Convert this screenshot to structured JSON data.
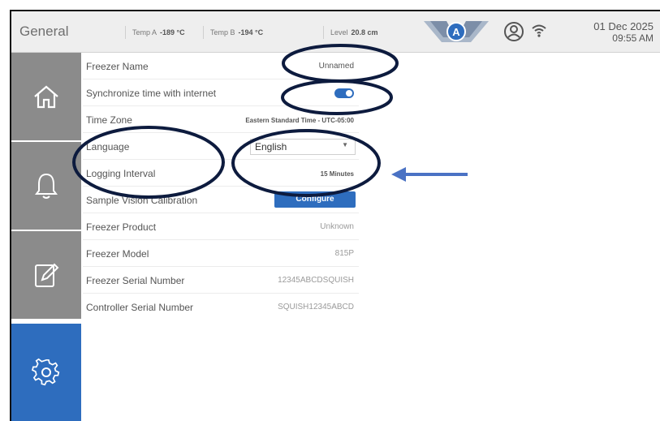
{
  "header": {
    "title": "General",
    "temp_a_label": "Temp A",
    "temp_a_value": "-189 °C",
    "temp_b_label": "Temp B",
    "temp_b_value": "-194 °C",
    "level_label": "Level",
    "level_value": "20.8 cm",
    "badge_letter": "A",
    "date": "01 Dec 2025",
    "time": "09:55 AM"
  },
  "sidebar": {
    "items": [
      {
        "icon": "home-icon",
        "active": false
      },
      {
        "icon": "bell-icon",
        "active": false
      },
      {
        "icon": "edit-icon",
        "active": false
      },
      {
        "icon": "gear-icon",
        "active": true
      }
    ]
  },
  "settings": {
    "freezer_name_label": "Freezer Name",
    "freezer_name_value": "Unnamed",
    "sync_label": "Synchronize time with internet",
    "sync_enabled": true,
    "timezone_label": "Time Zone",
    "timezone_value": "Eastern Standard Time - UTC-05:00",
    "language_label": "Language",
    "language_value": "English",
    "logging_label": "Logging Interval",
    "logging_value": "15 Minutes",
    "calibration_label": "Sample Vision Calibration",
    "calibration_button": "Configure",
    "product_label": "Freezer Product",
    "product_value": "Unknown",
    "model_label": "Freezer Model",
    "model_value": "815P",
    "serial_label": "Freezer Serial Number",
    "serial_value": "12345ABCDSQUISH",
    "controller_label": "Controller Serial Number",
    "controller_value": "SQUISH12345ABCD"
  },
  "colors": {
    "accent": "#2e6dbe",
    "sidebar_gray": "#8b8b8b",
    "annotation": "#0d1b3e",
    "arrow": "#4a72c4"
  }
}
